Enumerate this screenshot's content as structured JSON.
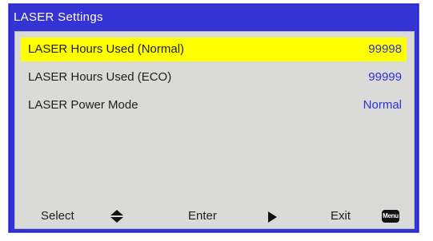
{
  "window": {
    "title": "LASER Settings"
  },
  "rows": [
    {
      "label": "LASER Hours Used (Normal)",
      "value": "99998",
      "selected": true
    },
    {
      "label": "LASER Hours Used (ECO)",
      "value": "99999",
      "selected": false
    },
    {
      "label": "LASER Power Mode",
      "value": "Normal",
      "selected": false
    }
  ],
  "footer": {
    "select_label": "Select",
    "select_icon": "up-down-arrows-icon",
    "enter_label": "Enter",
    "enter_icon": "right-arrow-icon",
    "exit_label": "Exit",
    "exit_icon": "menu-button-icon",
    "menu_key_text": "Menu"
  },
  "colors": {
    "window_bg": "#3433d3",
    "panel_bg": "#dadad8",
    "highlight": "#ffff00",
    "value_text": "#2e33d6"
  }
}
